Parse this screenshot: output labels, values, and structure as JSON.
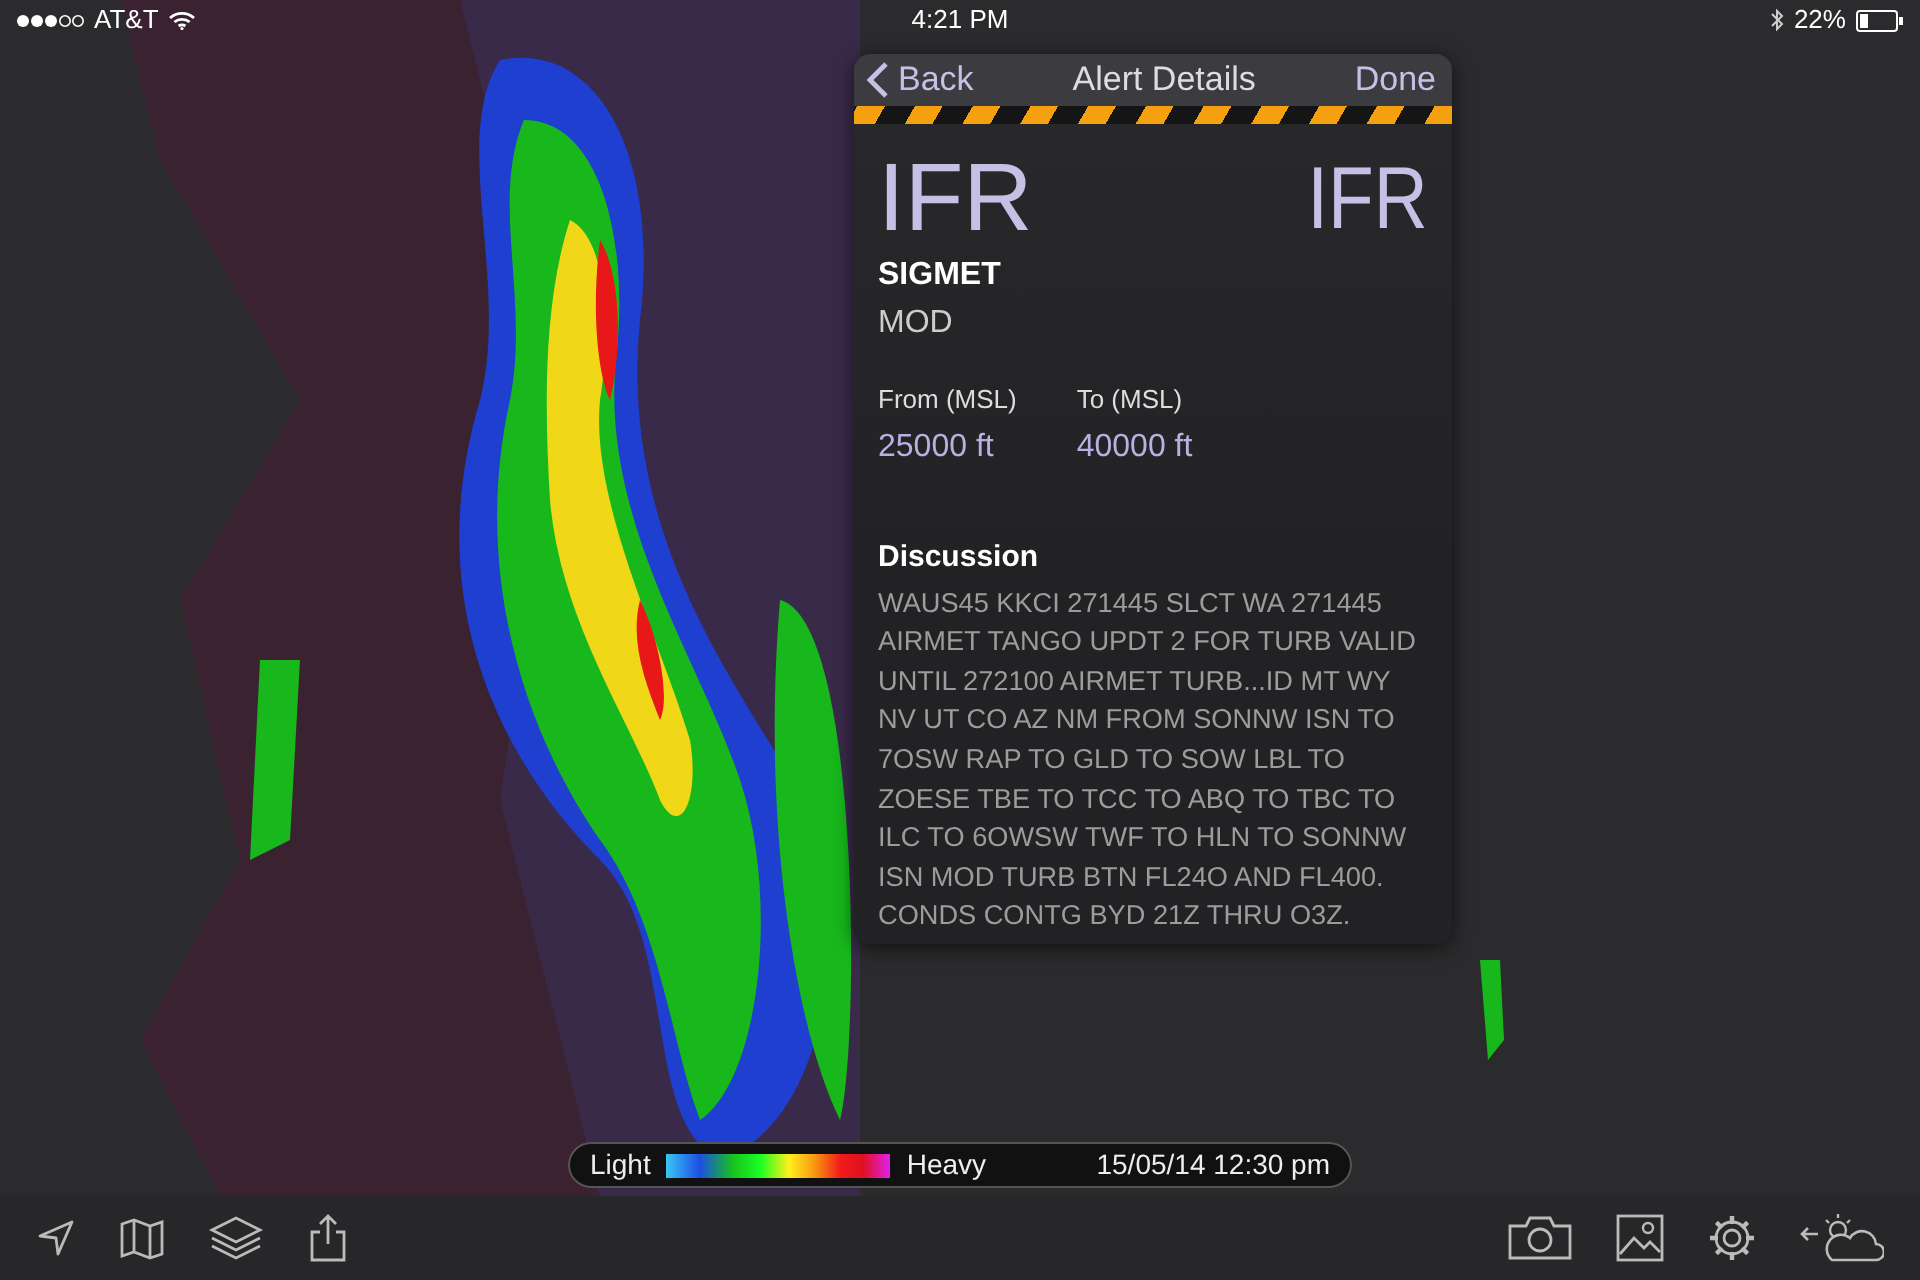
{
  "status_bar": {
    "carrier": "AT&T",
    "time": "4:21 PM",
    "battery": "22%"
  },
  "alert": {
    "nav": {
      "back": "Back",
      "title": "Alert Details",
      "done": "Done"
    },
    "category": "IFR",
    "category_badge": "IFR",
    "type": "SIGMET",
    "severity": "MOD",
    "altitudes": [
      {
        "label": "From (MSL)",
        "value": "25000 ft"
      },
      {
        "label": "To (MSL)",
        "value": "40000 ft"
      }
    ],
    "discussion_title": "Discussion",
    "discussion": "WAUS45 KKCI 271445 SLCT WA 271445 AIRMET TANGO UPDT 2 FOR TURB VALID UNTIL 272100 AIRMET TURB...ID MT WY NV UT CO AZ NM FROM SONNW ISN TO 7OSW RAP TO GLD TO SOW LBL TO ZOESE TBE TO TCC TO ABQ TO TBC TO ILC TO 6OWSW TWF TO HLN TO SONNW ISN MOD TURB BTN FL24O AND FL400. CONDS CONTG BYD 21Z THRU O3Z."
  },
  "legend": {
    "low_label": "Light",
    "high_label": "Heavy",
    "timestamp": "15/05/14 12:30 pm"
  }
}
